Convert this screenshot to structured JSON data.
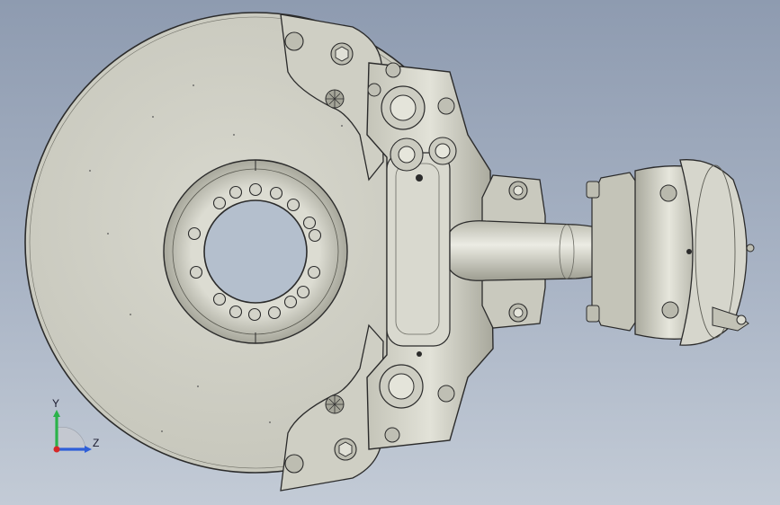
{
  "viewport": {
    "background_top": "#8e9bb0",
    "background_bottom": "#c3cbd6"
  },
  "model": {
    "part_fill": "#d2d2c8",
    "part_shade": "#b6b6aa",
    "part_dark": "#8f8f85",
    "edge_color": "#2b2b2b"
  },
  "triad": {
    "y_label": "Y",
    "z_label": "Z",
    "y_color": "#2bb34a",
    "z_color": "#2f5fd8",
    "x_color": "#d62828"
  }
}
